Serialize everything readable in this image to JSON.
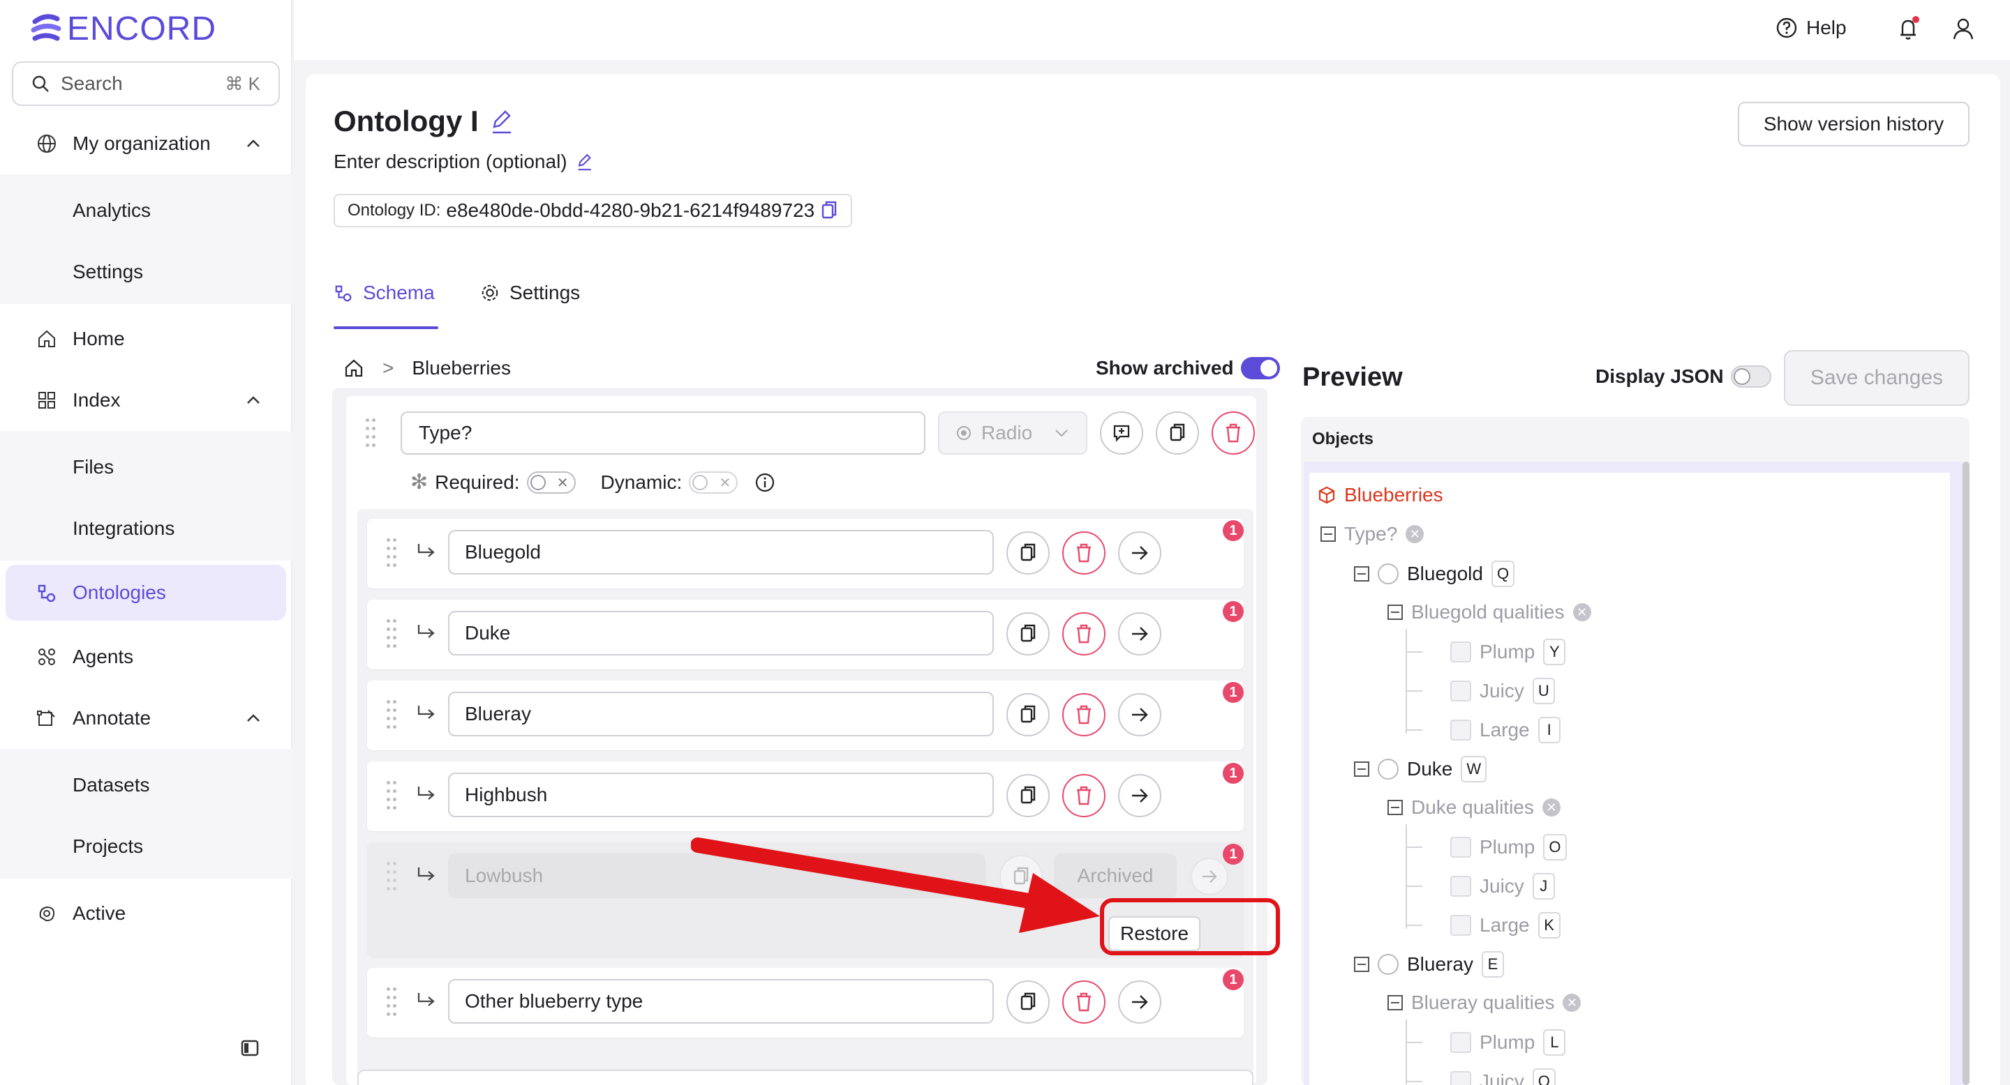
{
  "brand": {
    "name": "ENCORD",
    "color": "#5b4bd8"
  },
  "search": {
    "placeholder": "Search",
    "shortcut": "⌘ K"
  },
  "sidebar": {
    "org": "My organization",
    "org_items": [
      "Analytics",
      "Settings"
    ],
    "home": "Home",
    "index": "Index",
    "index_items": [
      "Files",
      "Integrations"
    ],
    "ontologies": "Ontologies",
    "agents": "Agents",
    "annotate": "Annotate",
    "annotate_items": [
      "Datasets",
      "Projects"
    ],
    "active": "Active"
  },
  "topbar": {
    "help": "Help",
    "has_notification": true
  },
  "ontology": {
    "title": "Ontology I",
    "description": "Enter description (optional)",
    "id_label": "Ontology ID:",
    "id_value": "e8e480de-0bdd-4280-9b21-6214f9489723",
    "version_history_button": "Show version history"
  },
  "tabs": {
    "schema": "Schema",
    "settings": "Settings",
    "active": "Schema"
  },
  "breadcrumb": {
    "current": "Blueberries"
  },
  "show_archived": {
    "label": "Show archived",
    "on": true
  },
  "question": {
    "value": "Type?",
    "type": "Radio",
    "required_label": "Required:",
    "dynamic_label": "Dynamic:",
    "required_on": false,
    "dynamic_on": false
  },
  "options": [
    {
      "label": "Bluegold",
      "badge": "1",
      "archived": false
    },
    {
      "label": "Duke",
      "badge": "1",
      "archived": false
    },
    {
      "label": "Blueray",
      "badge": "1",
      "archived": false
    },
    {
      "label": "Highbush",
      "badge": "1",
      "archived": false
    },
    {
      "label": "Lowbush",
      "badge": "1",
      "archived": true,
      "archived_tag": "Archived",
      "restore_label": "Restore"
    },
    {
      "label": "Other blueberry type",
      "badge": "1",
      "archived": false
    }
  ],
  "preview": {
    "title": "Preview",
    "display_json_label": "Display JSON",
    "display_json_on": false,
    "save_button": "Save changes",
    "objects_label": "Objects",
    "object_name": "Blueberries",
    "object_color": "#d9381e",
    "question": "Type?",
    "tree": [
      {
        "name": "Bluegold",
        "key": "Q",
        "group": "Bluegold qualities",
        "items": [
          {
            "name": "Plump",
            "key": "Y"
          },
          {
            "name": "Juicy",
            "key": "U"
          },
          {
            "name": "Large",
            "key": "I"
          }
        ]
      },
      {
        "name": "Duke",
        "key": "W",
        "group": "Duke qualities",
        "items": [
          {
            "name": "Plump",
            "key": "O"
          },
          {
            "name": "Juicy",
            "key": "J"
          },
          {
            "name": "Large",
            "key": "K"
          }
        ]
      },
      {
        "name": "Blueray",
        "key": "E",
        "group": "Blueray qualities",
        "items": [
          {
            "name": "Plump",
            "key": "L"
          },
          {
            "name": "Juicy",
            "key": "O"
          }
        ]
      }
    ]
  },
  "annotation_color": "#e01318",
  "accent_color": "#5b4bd8",
  "danger_color": "#e8496b"
}
